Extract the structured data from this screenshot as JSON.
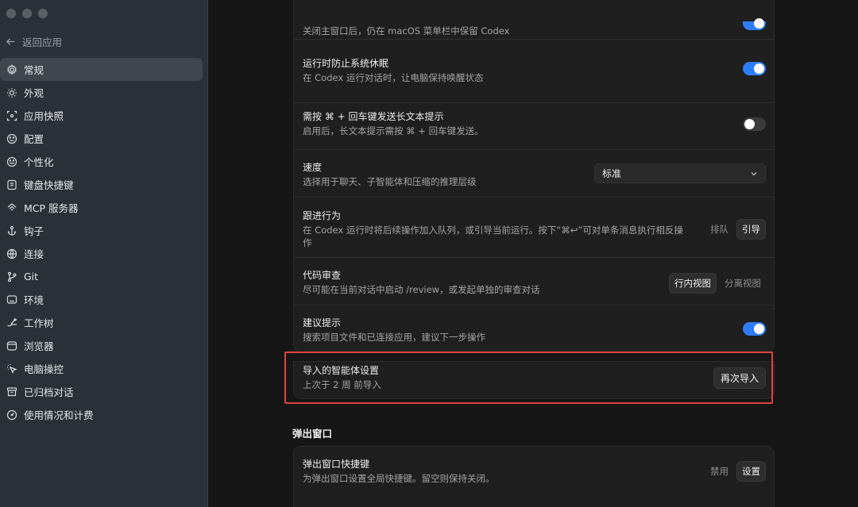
{
  "sidebar": {
    "back_label": "返回应用",
    "items": [
      {
        "label": "常规",
        "icon": "gear-icon",
        "active": true
      },
      {
        "label": "外观",
        "icon": "sun-icon"
      },
      {
        "label": "应用快照",
        "icon": "snapshot-icon"
      },
      {
        "label": "配置",
        "icon": "config-icon"
      },
      {
        "label": "个性化",
        "icon": "smile-icon"
      },
      {
        "label": "键盘快捷键",
        "icon": "keyboard-icon"
      },
      {
        "label": "MCP 服务器",
        "icon": "mcp-icon"
      },
      {
        "label": "钩子",
        "icon": "hook-icon"
      },
      {
        "label": "连接",
        "icon": "globe-icon"
      },
      {
        "label": "Git",
        "icon": "git-branch-icon"
      },
      {
        "label": "环境",
        "icon": "monitor-icon"
      },
      {
        "label": "工作树",
        "icon": "worktree-icon"
      },
      {
        "label": "浏览器",
        "icon": "browser-icon"
      },
      {
        "label": "电脑操控",
        "icon": "cursor-icon"
      },
      {
        "label": "已归档对话",
        "icon": "archive-icon"
      },
      {
        "label": "使用情况和计费",
        "icon": "gauge-icon"
      }
    ]
  },
  "settings": {
    "menubar": {
      "desc": "关闭主窗口后，仍在 macOS 菜单栏中保留 Codex",
      "enabled": true
    },
    "prevent_sleep": {
      "title": "运行时防止系统休眠",
      "desc": "在 Codex 运行对话时，让电脑保持唤醒状态",
      "enabled": true
    },
    "cmd_enter": {
      "title": "需按 ⌘ + 回车键发送长文本提示",
      "desc": "启用后，长文本提示需按 ⌘ + 回车键发送。",
      "enabled": false
    },
    "speed": {
      "title": "速度",
      "desc": "选择用于聊天、子智能体和压缩的推理层级",
      "value": "标准"
    },
    "follow_up": {
      "title": "跟进行为",
      "desc": "在 Codex 运行时将后续操作加入队列，或引导当前运行。按下“⌘↩”可对单条消息执行相反操作",
      "opt_queue": "排队",
      "opt_steer": "引导",
      "selected": "引导"
    },
    "code_review": {
      "title": "代码审查",
      "desc": "尽可能在当前对话中启动 /review，或发起单独的审查对话",
      "opt_inline": "行内视图",
      "opt_separate": "分离视图",
      "selected": "行内视图"
    },
    "suggestions": {
      "title": "建议提示",
      "desc": "搜索项目文件和已连接应用，建议下一步操作",
      "enabled": true
    },
    "imported_agent": {
      "title": "导入的智能体设置",
      "desc": "上次于 2 周 前导入",
      "button": "再次导入"
    }
  },
  "popup_section": {
    "heading": "弹出窗口",
    "shortcut": {
      "title": "弹出窗口快捷键",
      "desc": "为弹出窗口设置全局快捷键。留空则保持关闭。",
      "opt_disable": "禁用",
      "opt_set": "设置"
    }
  },
  "colors": {
    "accent": "#2f7df6",
    "highlight_border": "#e0443e",
    "sidebar_bg": "#2c3038",
    "main_bg": "#161616"
  }
}
